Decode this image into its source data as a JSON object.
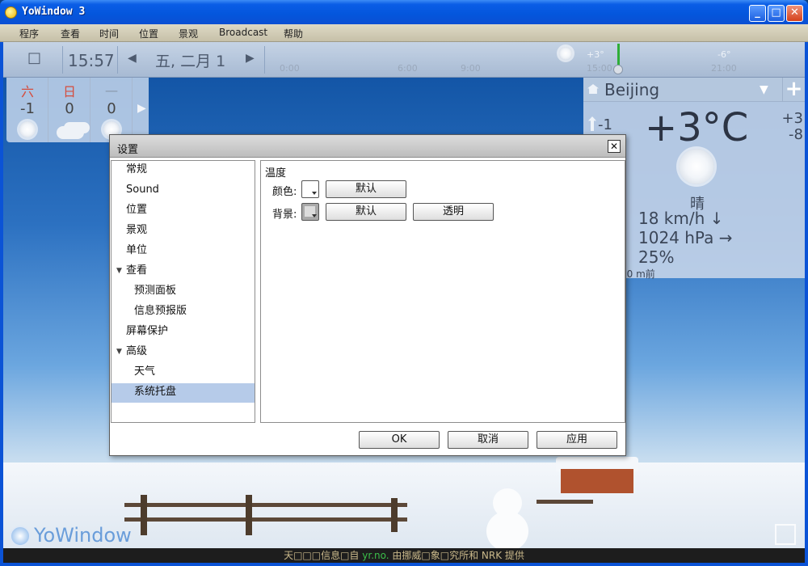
{
  "window": {
    "title": "YoWindow 3",
    "buttons": {
      "minimize": "_",
      "maximize": "□",
      "close": "✕"
    }
  },
  "menu": [
    "程序",
    "查看",
    "时间",
    "位置",
    "景观",
    "Broadcast",
    "帮助"
  ],
  "timebar": {
    "checkbox": "□",
    "clock": "15:57",
    "prev": "◀",
    "date": "五, 二月 1",
    "next": "▶",
    "ticks": [
      "0:00",
      "6:00",
      "9:00",
      "15:00",
      "21:00"
    ],
    "temp_marks": [
      "+3°",
      "-6°"
    ]
  },
  "forecast": {
    "days": [
      "六",
      "日",
      "一"
    ],
    "temps": [
      "-1",
      "0",
      "0"
    ],
    "icons": [
      "sun-icon",
      "cloud-icon",
      "sun-icon"
    ],
    "more": "▶"
  },
  "city": {
    "name": "Beijing",
    "dropdown": "▼",
    "add": "+",
    "feels_like": "-1",
    "temperature": "+3°C",
    "high": "+3",
    "low": "-8",
    "condition": "晴",
    "wind": "18 km/h ↓",
    "pressure": "1024 hPa →",
    "humidity": "25%",
    "updated": "30 m前"
  },
  "logo": "YoWindow",
  "credits": {
    "prefix": "天□□□信息□自",
    "source": "yr.no.",
    "suffix": "由挪威□象□究所和 NRK 提供"
  },
  "dialog": {
    "title": "设置",
    "close": "✕",
    "tree": [
      {
        "label": "常规",
        "level": 0
      },
      {
        "label": "Sound",
        "level": 0
      },
      {
        "label": "位置",
        "level": 0
      },
      {
        "label": "景观",
        "level": 0
      },
      {
        "label": "单位",
        "level": 0
      },
      {
        "label": "查看",
        "level": 0,
        "expanded": true
      },
      {
        "label": "预测面板",
        "level": 1
      },
      {
        "label": "信息预报版",
        "level": 1
      },
      {
        "label": "屏幕保护",
        "level": 0
      },
      {
        "label": "高级",
        "level": 0,
        "expanded": true
      },
      {
        "label": "天气",
        "level": 1
      },
      {
        "label": "系统托盘",
        "level": 1,
        "selected": true
      }
    ],
    "caret": "▼",
    "section": "温度",
    "color_label": "颜色:",
    "bg_label": "背景:",
    "default_btn": "默认",
    "transparent_btn": "透明",
    "ok": "OK",
    "cancel": "取消",
    "apply": "应用"
  }
}
